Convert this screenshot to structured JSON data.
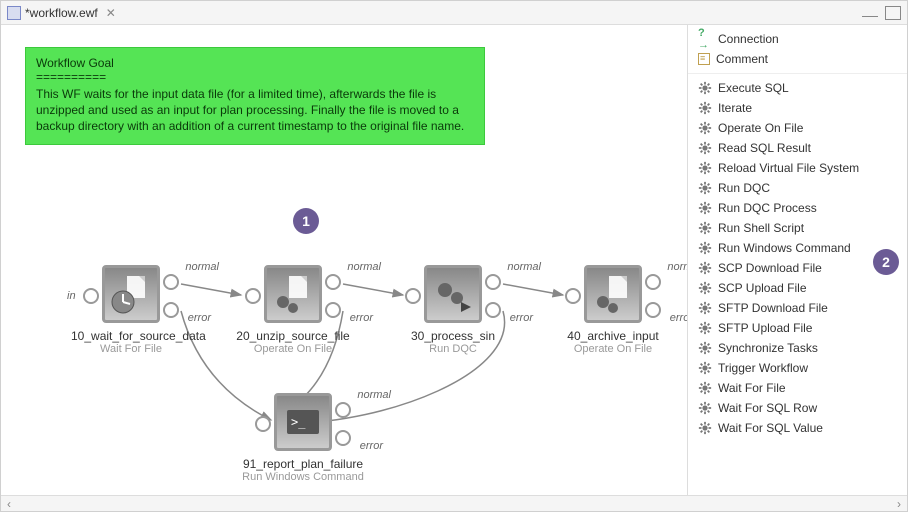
{
  "tab": {
    "title": "*workflow.ewf"
  },
  "goal": {
    "header": "Workflow Goal",
    "separator": "==========",
    "body": "This WF waits for the input data file (for a limited time), afterwards the file is unzipped and used as an input for plan processing. Finally the file is moved to a backup directory with an addition of a current timestamp to the original file name."
  },
  "callouts": {
    "one": "1",
    "two": "2"
  },
  "labels": {
    "in": "in",
    "normal": "normal",
    "error": "error"
  },
  "nodes": {
    "n1": {
      "name": "10_wait_for_source_data",
      "type": "Wait For File"
    },
    "n2": {
      "name": "20_unzip_source_file",
      "type": "Operate On File"
    },
    "n3": {
      "name": "30_process_sin",
      "type": "Run DQC"
    },
    "n4": {
      "name": "40_archive_input",
      "type": "Operate On File"
    },
    "n5": {
      "name": "91_report_plan_failure",
      "type": "Run Windows Command"
    }
  },
  "palette": {
    "top": [
      {
        "label": "Connection",
        "icon": "connection"
      },
      {
        "label": "Comment",
        "icon": "comment"
      }
    ],
    "tasks": [
      "Execute SQL",
      "Iterate",
      "Operate On File",
      "Read SQL Result",
      "Reload Virtual File System",
      "Run DQC",
      "Run DQC Process",
      "Run Shell Script",
      "Run Windows Command",
      "SCP Download File",
      "SCP Upload File",
      "SFTP Download File",
      "SFTP Upload File",
      "Synchronize Tasks",
      "Trigger Workflow",
      "Wait For File",
      "Wait For SQL Row",
      "Wait For SQL Value"
    ]
  }
}
